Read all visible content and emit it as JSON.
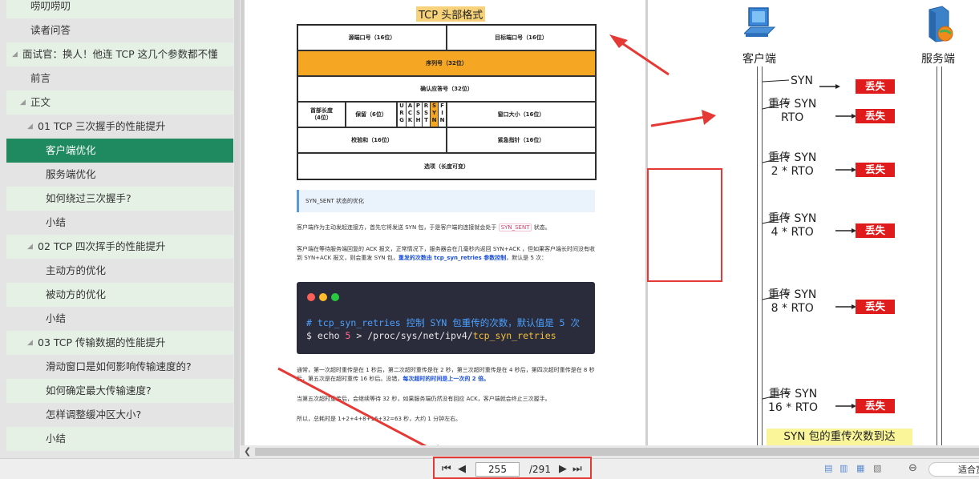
{
  "toc": {
    "items": [
      {
        "label": "唠叨唠叨",
        "indent": 1
      },
      {
        "label": "读者问答",
        "indent": 1
      },
      {
        "label": "面试官：换人！他连 TCP 这几个参数都不懂",
        "indent": 0,
        "expanded": true
      },
      {
        "label": "前言",
        "indent": 1
      },
      {
        "label": "正文",
        "indent": 1,
        "expanded": true
      },
      {
        "label": "01 TCP 三次握手的性能提升",
        "indent": 2,
        "expanded": true
      },
      {
        "label": "客户端优化",
        "indent": 3,
        "selected": true
      },
      {
        "label": "服务端优化",
        "indent": 3
      },
      {
        "label": "如何绕过三次握手?",
        "indent": 3
      },
      {
        "label": "小结",
        "indent": 3
      },
      {
        "label": "02 TCP 四次挥手的性能提升",
        "indent": 2,
        "expanded": true
      },
      {
        "label": "主动方的优化",
        "indent": 3
      },
      {
        "label": "被动方的优化",
        "indent": 3
      },
      {
        "label": "小结",
        "indent": 3
      },
      {
        "label": "03 TCP 传输数据的性能提升",
        "indent": 2,
        "expanded": true
      },
      {
        "label": "滑动窗口是如何影响传输速度的?",
        "indent": 3
      },
      {
        "label": "如何确定最大传输速度?",
        "indent": 3
      },
      {
        "label": "怎样调整缓冲区大小?",
        "indent": 3
      },
      {
        "label": "小结",
        "indent": 3
      }
    ]
  },
  "doc": {
    "tcp_title": "TCP 头部格式",
    "tcp_fields": {
      "src_port": "源端口号（16位）",
      "dst_port": "目标端口号（16位）",
      "seq": "序列号（32位）",
      "ack": "确认应答号（32位）",
      "header_len": "首部长度\n（4位）",
      "reserved": "保留（6位）",
      "window": "窗口大小（16位）",
      "checksum": "校验和（16位）",
      "urgent": "紧急指针（16位）",
      "options": "选项（长度可变）"
    },
    "tcp_flags": [
      {
        "chars": "URG",
        "highlight": false
      },
      {
        "chars": "ACK",
        "highlight": false
      },
      {
        "chars": "PSH",
        "highlight": false
      },
      {
        "chars": "RST",
        "highlight": false
      },
      {
        "chars": "SYN",
        "highlight": true
      },
      {
        "chars": "FIN",
        "highlight": false
      }
    ],
    "note_title": "SYN_SENT 状态的优化",
    "para1_a": "客户端作为主动发起连接方，首先它将发送 SYN 包，于是客户端的连接就会处于",
    "para1_code": "SYN_SENT",
    "para1_b": "状态。",
    "para2_a": "客户端在等待服务端回复的 ACK 报文，正常情况下，服务器会在几毫秒内返回 SYN+ACK ，但如果客户端长时间没有收到 SYN+ACK 报文，则会重发 SYN 包，",
    "para2_blue": "重发的次数由 tcp_syn_retries 参数控制",
    "para2_b": "，默认是 5 次：",
    "terminal_line1": "# tcp_syn_retries 控制 SYN 包重传的次数，默认值是 5 次",
    "terminal_line2_a": "$ echo",
    "terminal_line2_num": "5",
    "terminal_line2_b": "> /proc/sys/net/ipv4/",
    "terminal_line2_file": "tcp_syn_retries",
    "para3_a": "通常，第一次超时重传是在 1 秒后，第二次超时重传是在 2 秒，第三次超时重传是在 4 秒后，第四次超时重传是在 8 秒后，第五次是在超时重传 16 秒后。没错，",
    "para3_blue": "每次超时的时间是上一次的 2 倍。",
    "para4": "当第五次超时重传后，会继续等待 32 秒，如果服务端仍然没有回应 ACK，客户端就会终止三次握手。",
    "para5": "所以，总耗时是 1+2+4+8+16+32=63 秒，大约 1 分钟左右。"
  },
  "diagram": {
    "client_label": "客户端",
    "server_label": "服务端",
    "loss_label": "丢失",
    "attempts": [
      {
        "line1": "SYN",
        "line2": ""
      },
      {
        "line1": "重传 SYN",
        "line2": "RTO"
      },
      {
        "line1": "重传 SYN",
        "line2": "2 * RTO"
      },
      {
        "line1": "重传 SYN",
        "line2": "4 * RTO"
      },
      {
        "line1": "重传 SYN",
        "line2": "8 * RTO"
      },
      {
        "line1": "重传 SYN",
        "line2": "16 * RTO"
      }
    ],
    "bottom_banner": "SYN 包的重传次数到达"
  },
  "statusbar": {
    "current_page": "255",
    "total_pages": "/291",
    "fit_label": "适合宽度"
  },
  "colors": {
    "sidebar_selected": "#1f8a5f",
    "loss_red": "#e01b1b",
    "highlight_orange": "#f5a623",
    "annotation_red": "#e53935"
  }
}
